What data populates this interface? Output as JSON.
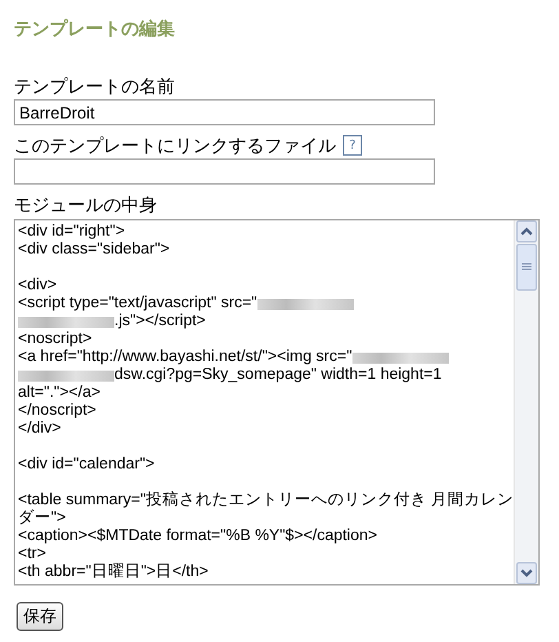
{
  "heading": "テンプレートの編集",
  "fields": [
    {
      "label": "テンプレートの名前",
      "value": "BarreDroit",
      "help": false
    },
    {
      "label": "このテンプレートにリンクするファイル",
      "help": true,
      "help_text": "?"
    }
  ],
  "module": {
    "label": "モジュールの中身",
    "lines": [
      {
        "kind": "code",
        "parts": [
          {
            "kind": "text",
            "text": "<div id=\"right\">"
          }
        ]
      },
      {
        "kind": "code",
        "parts": [
          {
            "kind": "text",
            "text": "<div class=\"sidebar\">"
          }
        ]
      },
      {
        "kind": "blank"
      },
      {
        "kind": "code",
        "parts": [
          {
            "kind": "text",
            "text": "<div>"
          }
        ]
      },
      {
        "kind": "code",
        "parts": [
          {
            "kind": "text",
            "text": "<script type=\"text/javascript\" src=\""
          },
          {
            "kind": "redacted"
          }
        ]
      },
      {
        "kind": "code",
        "parts": [
          {
            "kind": "redacted"
          },
          {
            "kind": "text",
            "text": ".js\"></script>"
          }
        ]
      },
      {
        "kind": "code",
        "parts": [
          {
            "kind": "text",
            "text": "<noscript>"
          }
        ]
      },
      {
        "kind": "code",
        "parts": [
          {
            "kind": "text",
            "text": "<a href=\"http://www.bayashi.net/st/\"><img src=\""
          },
          {
            "kind": "redacted"
          }
        ]
      },
      {
        "kind": "code",
        "parts": [
          {
            "kind": "redacted"
          },
          {
            "kind": "text",
            "text": "dsw.cgi?pg=Sky_somepage\" width=1 height=1"
          }
        ]
      },
      {
        "kind": "code",
        "parts": [
          {
            "kind": "text",
            "text": "alt=\".\"></a>"
          }
        ]
      },
      {
        "kind": "code",
        "parts": [
          {
            "kind": "text",
            "text": "</noscript>"
          }
        ]
      },
      {
        "kind": "code",
        "parts": [
          {
            "kind": "text",
            "text": "</div>"
          }
        ]
      },
      {
        "kind": "blank"
      },
      {
        "kind": "code",
        "parts": [
          {
            "kind": "text",
            "text": "<div id=\"calendar\">"
          }
        ]
      },
      {
        "kind": "blank"
      },
      {
        "kind": "code",
        "parts": [
          {
            "kind": "text",
            "text": "<table summary=\"投稿されたエントリーへのリンク付き 月間カレン"
          }
        ]
      },
      {
        "kind": "code",
        "parts": [
          {
            "kind": "text",
            "text": "ダー\">"
          }
        ]
      },
      {
        "kind": "code",
        "parts": [
          {
            "kind": "text",
            "text": "<caption><$MTDate format=\"%B %Y\"$></caption>"
          }
        ]
      },
      {
        "kind": "code",
        "parts": [
          {
            "kind": "text",
            "text": "<tr>"
          }
        ]
      },
      {
        "kind": "code",
        "parts": [
          {
            "kind": "text",
            "text": "<th abbr=\"日曜日\">日</th>"
          }
        ]
      }
    ]
  },
  "save_button": "保存"
}
